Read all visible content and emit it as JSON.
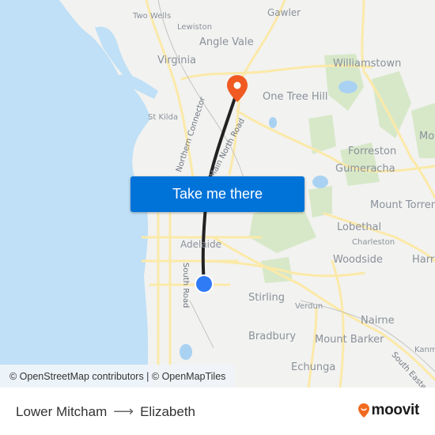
{
  "map": {
    "labels": {
      "two_wells": "Two Wells",
      "lewiston": "Lewiston",
      "gawler": "Gawler",
      "angle_vale": "Angle Vale",
      "virginia": "Virginia",
      "williamstown": "Williamstown",
      "one_tree_hill": "One Tree Hill",
      "st_kilda": "St Kilda",
      "forreston": "Forreston",
      "gumeracha": "Gumeracha",
      "mo": "Mo",
      "mount_torrens": "Mount Torrens",
      "lobethal": "Lobethal",
      "charleston": "Charleston",
      "woodside": "Woodside",
      "harr": "Harr",
      "adelaide": "Adelaide",
      "stirling": "Stirling",
      "verdun": "Verdun",
      "nairne": "Nairne",
      "bradbury": "Bradbury",
      "mount_barker": "Mount Barker",
      "kanm": "Kanm",
      "echunga": "Echunga"
    },
    "roads": {
      "northern_connector": "Northern Connector",
      "main_north_road": "Main North Road",
      "south_road": "South Road",
      "south_eastern": "South Eastern F"
    },
    "origin_marker": {
      "icon": "origin-dot-icon",
      "color": "#2f7bf5"
    },
    "destination_marker": {
      "icon": "map-pin-icon",
      "color": "#f05a22"
    },
    "route_color": "#222222",
    "attribution": "© OpenStreetMap contributors | © OpenMapTiles"
  },
  "cta": {
    "label": "Take me there",
    "color": "#0073d9"
  },
  "footer": {
    "origin": "Lower Mitcham",
    "arrow": "⟶",
    "destination": "Elizabeth",
    "brand": "moovit",
    "brand_color": "#f26b21"
  }
}
